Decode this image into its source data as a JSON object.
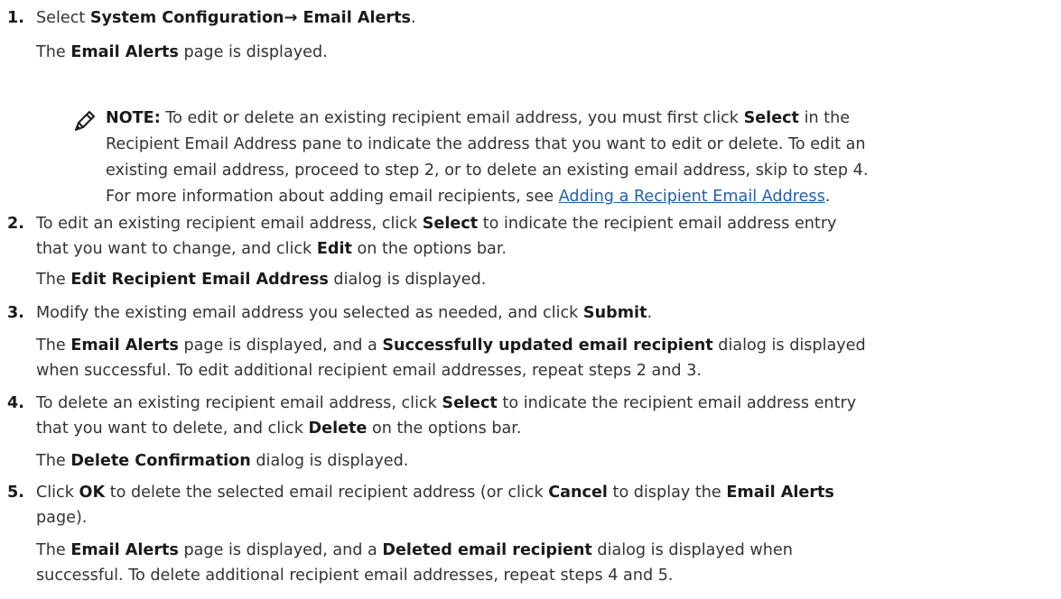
{
  "steps": [
    {
      "number": "1.",
      "instruction": {
        "pre": "Select ",
        "b1": "System Configuration→ Email Alerts",
        "post": "."
      },
      "result": {
        "pre": "The ",
        "b1": "Email Alerts",
        "post": " page is displayed."
      }
    },
    {
      "number": "2.",
      "instruction": {
        "l1_pre": "To edit an existing recipient email address, click ",
        "l1_b1": "Select",
        "l1_post": " to indicate the recipient email address entry",
        "l2_pre": "that you want to change, and click ",
        "l2_b1": "Edit",
        "l2_post": " on the options bar."
      },
      "result": {
        "pre": "The ",
        "b1": "Edit Recipient Email Address",
        "post": " dialog is displayed."
      }
    },
    {
      "number": "3.",
      "instruction": {
        "pre": "Modify the existing email address you selected as needed, and click ",
        "b1": "Submit",
        "post": "."
      },
      "result": {
        "l1_pre": "The ",
        "l1_b1": "Email Alerts",
        "l1_mid": " page is displayed, and a ",
        "l1_b2": "Successfully updated email recipient",
        "l1_post": " dialog is displayed",
        "l2": "when successful. To edit additional recipient email addresses, repeat steps 2 and 3."
      }
    },
    {
      "number": "4.",
      "instruction": {
        "l1_pre": "To delete an existing recipient email address, click ",
        "l1_b1": "Select",
        "l1_post": " to indicate the recipient email address entry",
        "l2_pre": "that you want to delete, and click ",
        "l2_b1": "Delete",
        "l2_post": " on the options bar."
      },
      "result": {
        "pre": "The ",
        "b1": "Delete Confirmation",
        "post": " dialog is displayed."
      }
    },
    {
      "number": "5.",
      "instruction": {
        "l1_pre": "Click ",
        "l1_b1": "OK",
        "l1_mid": " to delete the selected email recipient address (or click ",
        "l1_b2": "Cancel",
        "l1_mid2": " to display the ",
        "l1_b3": "Email Alerts",
        "l2": "page)."
      },
      "result": {
        "l1_pre": "The ",
        "l1_b1": "Email Alerts",
        "l1_mid": " page is displayed, and a ",
        "l1_b2": "Deleted email recipient",
        "l1_post": " dialog is displayed when",
        "l2": "successful. To delete additional recipient email addresses, repeat steps 4 and 5."
      }
    }
  ],
  "note": {
    "icon": "pencil-note-icon",
    "label": "NOTE:",
    "l1_pre": " To edit or delete an existing recipient email address, you must first click ",
    "l1_b1": "Select",
    "l1_post": " in the",
    "l2": "Recipient Email Address pane to indicate the address that you want to edit or delete. To edit an",
    "l3": "existing email address, proceed to step 2, or to delete an existing email address, skip to step 4.",
    "l4_pre": "For more information about adding email recipients, see ",
    "l4_link": "Adding a Recipient Email Address",
    "l4_post": "."
  },
  "colors": {
    "text": "#333333",
    "bold": "#1a1a1a",
    "link": "#1f5fb4"
  }
}
